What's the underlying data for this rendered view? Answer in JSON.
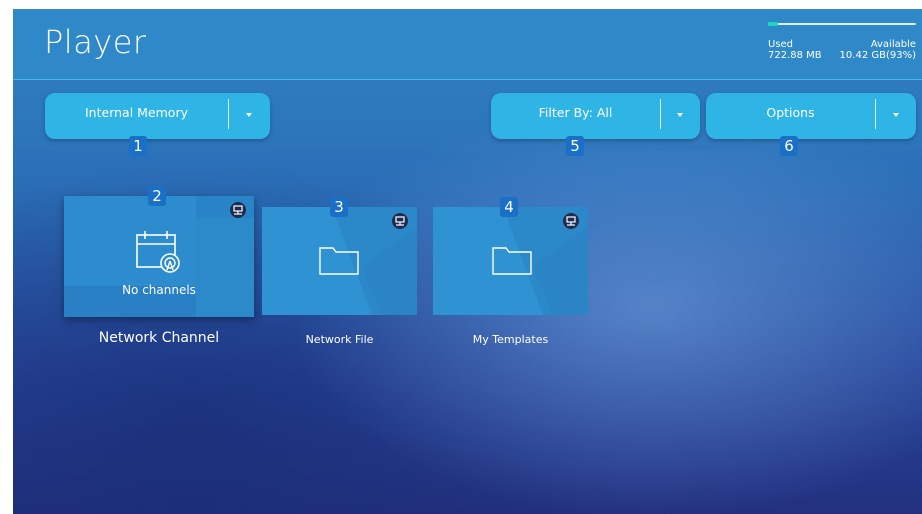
{
  "header": {
    "title": "Player"
  },
  "storage": {
    "used_label": "Used",
    "used_value": "722.88 MB",
    "available_label": "Available",
    "available_value": "10.42 GB(93%)",
    "used_fraction": 0.07
  },
  "toolbar": {
    "storage_dropdown": {
      "label": "Internal Memory",
      "badge": "1"
    },
    "filter_dropdown": {
      "label": "Filter By: All",
      "badge": "5"
    },
    "options_dropdown": {
      "label": "Options",
      "badge": "6"
    }
  },
  "tiles": [
    {
      "badge": "2",
      "content_text": "No channels",
      "caption": "Network Channel",
      "icon": "calendar-broadcast-icon"
    },
    {
      "badge": "3",
      "caption": "Network File",
      "icon": "folder-icon"
    },
    {
      "badge": "4",
      "caption": "My Templates",
      "icon": "folder-icon"
    }
  ],
  "colors": {
    "header_bg": "#2f89c9",
    "dropdown_bg": "#2fb4e6",
    "badge_bg": "#1a6fc7",
    "storage_accent": "#22d3c5"
  }
}
